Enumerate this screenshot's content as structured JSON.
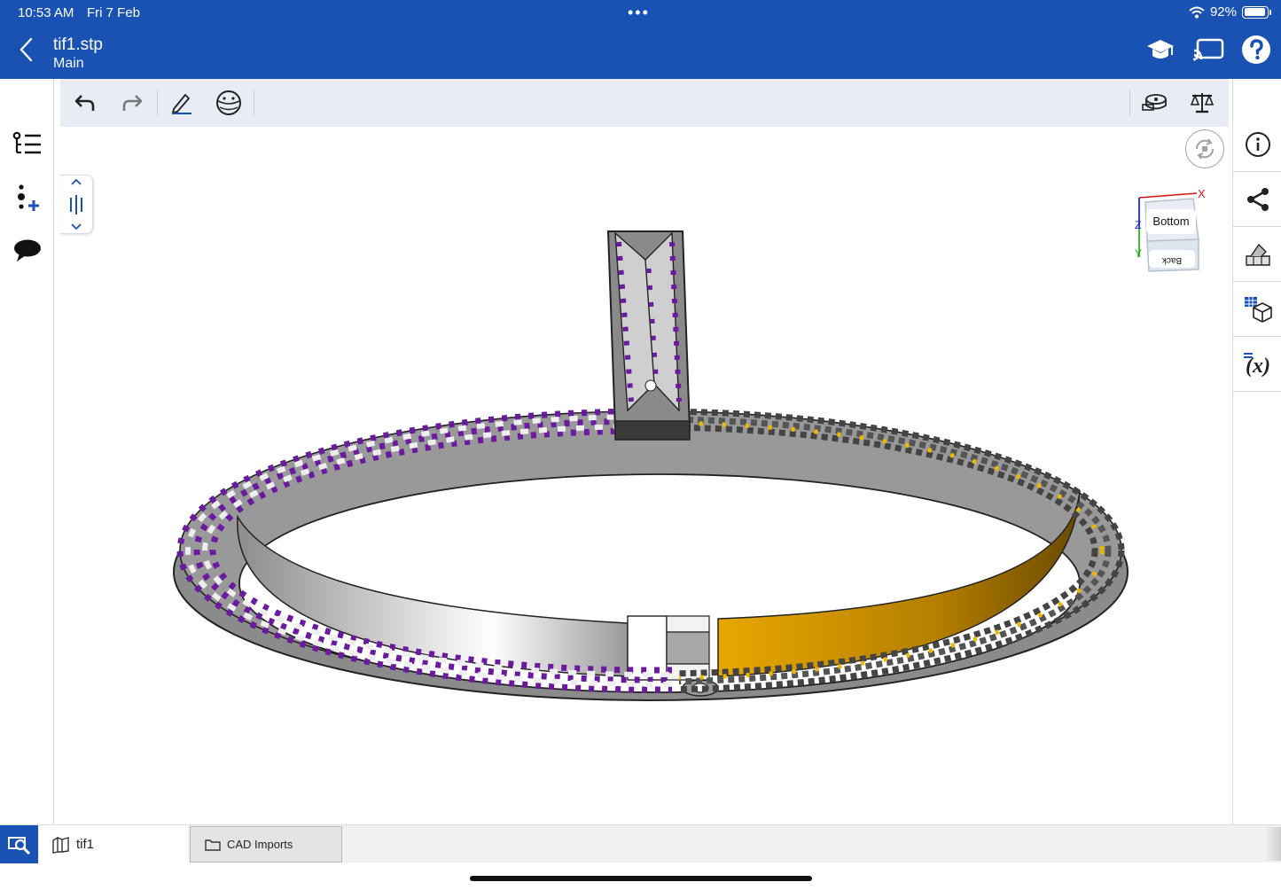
{
  "status_bar": {
    "time": "10:53 AM",
    "date": "Fri 7 Feb",
    "dots": "•••",
    "battery": "92%",
    "battery_level": 0.92,
    "icons": [
      "wifi-icon",
      "battery-icon"
    ]
  },
  "header": {
    "title": "tif1.stp",
    "subtitle": "Main",
    "icons": [
      "chevron-left-icon",
      "graduation-cap-icon",
      "cast-icon",
      "help-icon"
    ]
  },
  "left_sidebar": {
    "icons": [
      "feature-tree-icon",
      "add-mate-icon",
      "comments-icon"
    ]
  },
  "toolbar": {
    "left_icons": [
      "undo-icon",
      "redo-icon",
      "sketch-pencil-icon",
      "view-mode-icon"
    ],
    "right_icons": [
      "measure-tape-icon",
      "mass-properties-icon"
    ]
  },
  "right_sidebar": {
    "icons": [
      "info-icon",
      "share-icon",
      "appearance-icon",
      "configurations-icon",
      "variables-icon"
    ],
    "variables_label": "(x)"
  },
  "viewcube": {
    "face_front": "Bottom",
    "face_lower": "Back",
    "axis_x": "X",
    "axis_y": "Y",
    "axis_z": "Z"
  },
  "bottom_bar": {
    "tabs": [
      {
        "label": "tif1",
        "icon": "part-studio-icon"
      },
      {
        "label": "CAD Imports",
        "icon": "folder-icon"
      }
    ]
  },
  "colors": {
    "brand_blue": "#1a52b3",
    "gem_purple": "#6a1a9e",
    "gold": "#d99e00",
    "metal": "#8a8a8a"
  }
}
